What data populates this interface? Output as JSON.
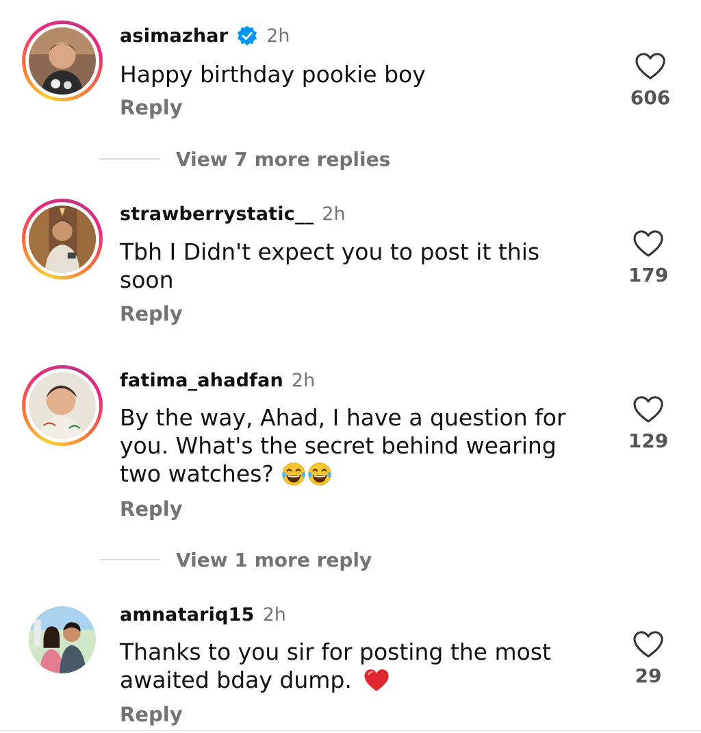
{
  "comments": [
    {
      "username": "asimazhar",
      "verified": true,
      "time": "2h",
      "text": "Happy birthday pookie boy",
      "reply_label": "Reply",
      "likes": "606",
      "view_more": "View 7 more replies"
    },
    {
      "username": "strawberrystatic__",
      "verified": false,
      "time": "2h",
      "text": "Tbh I Didn't expect you to post it this soon",
      "reply_label": "Reply",
      "likes": "179"
    },
    {
      "username": "fatima_ahadfan",
      "verified": false,
      "time": "2h",
      "text": "By the way, Ahad, I have a question for you. What's the secret behind wearing two watches?",
      "emoji": "😂😂",
      "reply_label": "Reply",
      "likes": "129",
      "view_more": "View 1 more reply"
    },
    {
      "username": "amnatariq15",
      "verified": false,
      "time": "2h",
      "text": "Thanks to you sir for posting the most awaited bday dump.",
      "emoji": "❤️",
      "reply_label": "Reply",
      "likes": "29"
    }
  ],
  "icons": {
    "like": "heart-outline-icon",
    "verified": "verified-badge-icon",
    "laugh_emoji": "face-with-tears-of-joy-icon",
    "heart_emoji": "red-heart-icon"
  },
  "colors": {
    "verified_blue": "#0095f6",
    "muted_text": "#737373",
    "story_ring": "#ee2a7b"
  }
}
